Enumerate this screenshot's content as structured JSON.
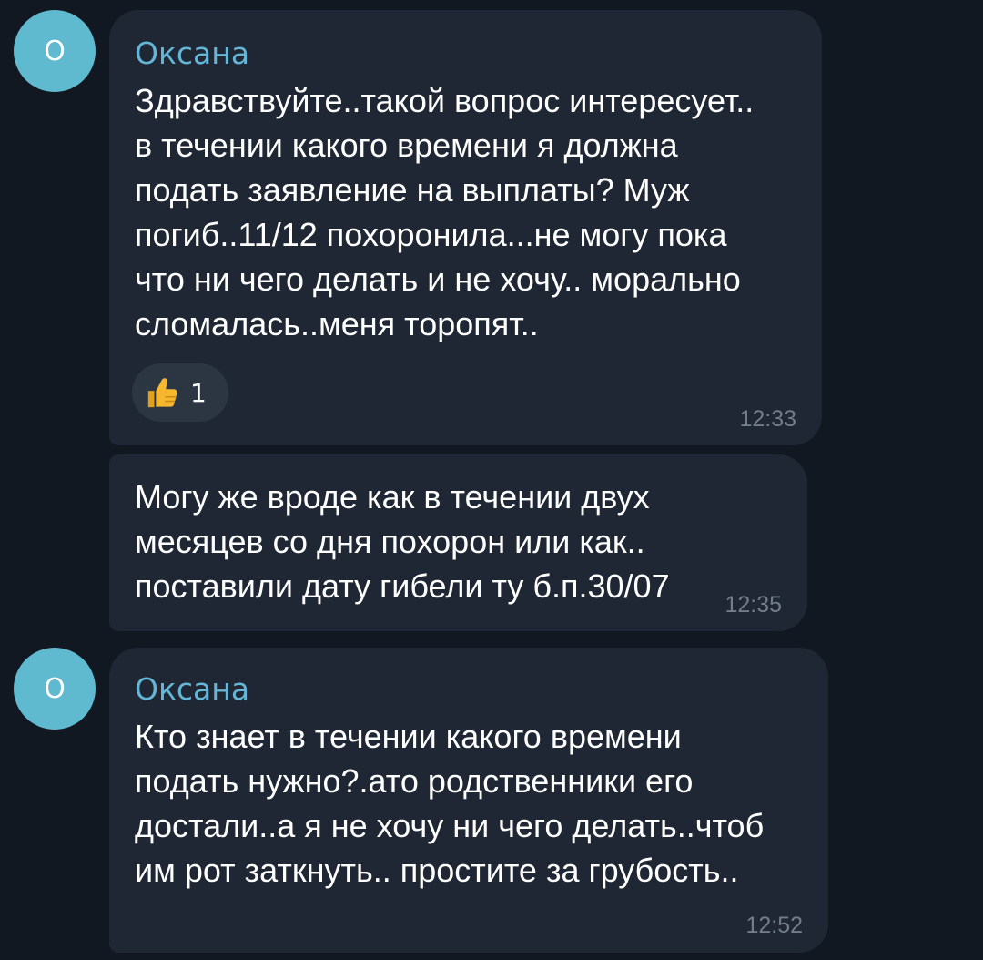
{
  "messages": [
    {
      "avatar_letter": "О",
      "sender": "Оксана",
      "lines": [
        "Здравствуйте..такой вопрос интересует..",
        "в течении какого времени я должна",
        "подать заявление на выплаты? Муж",
        "погиб..11/12 похоронила...не могу пока",
        "что ни чего делать и не хочу.. морально",
        "сломалась..меня торопят.."
      ],
      "reaction": {
        "icon": "thumbs-up-icon",
        "count": "1"
      },
      "time": "12:33"
    },
    {
      "lines": [
        "Могу же вроде как в течении двух",
        "месяцев со дня похорон или как..",
        "поставили дату гибели ту б.п.30/07"
      ],
      "time": "12:35"
    },
    {
      "avatar_letter": "О",
      "sender": "Оксана",
      "lines": [
        "Кто знает в течении какого времени",
        "подать нужно?.ато родственники его",
        "достали..а я не хочу ни чего делать..чтоб",
        "им рот заткнуть.. простите за грубость.."
      ],
      "time": "12:52"
    }
  ],
  "colors": {
    "background": "#111821",
    "bubble": "#1e2733",
    "sender": "#64b5d6",
    "avatar": "#5fb9cf",
    "time": "#727d89",
    "reaction": "#2c3642"
  }
}
